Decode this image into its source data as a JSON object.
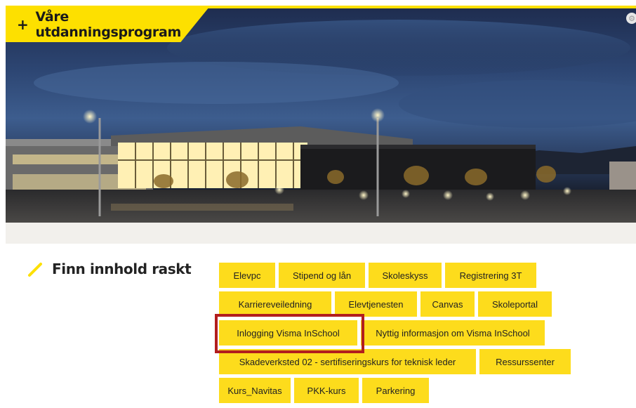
{
  "hero": {
    "program_tab_label": "Våre utdanningsprogram",
    "plus_glyph": "+",
    "corner_icon": "settings-circle-icon"
  },
  "quick": {
    "title": "Finn innhold raskt",
    "rows": [
      [
        "Elevpc",
        "Stipend og lån",
        "Skoleskyss",
        "Registrering 3T"
      ],
      [
        "Karriereveiledning",
        "Elevtjenesten",
        "Canvas",
        "Skoleportal"
      ],
      [
        "Inlogging Visma InSchool",
        "Nyttig informasjon om Visma InSchool"
      ],
      [
        "Skadeverksted 02 - sertifiseringskurs for teknisk leder",
        "Ressurssenter"
      ],
      [
        "Kurs_Navitas",
        "PKK-kurs",
        "Parkering"
      ]
    ]
  },
  "colors": {
    "accent_yellow": "#fde000",
    "button_yellow": "#fddc1c",
    "highlight_red": "#b21e1e"
  }
}
